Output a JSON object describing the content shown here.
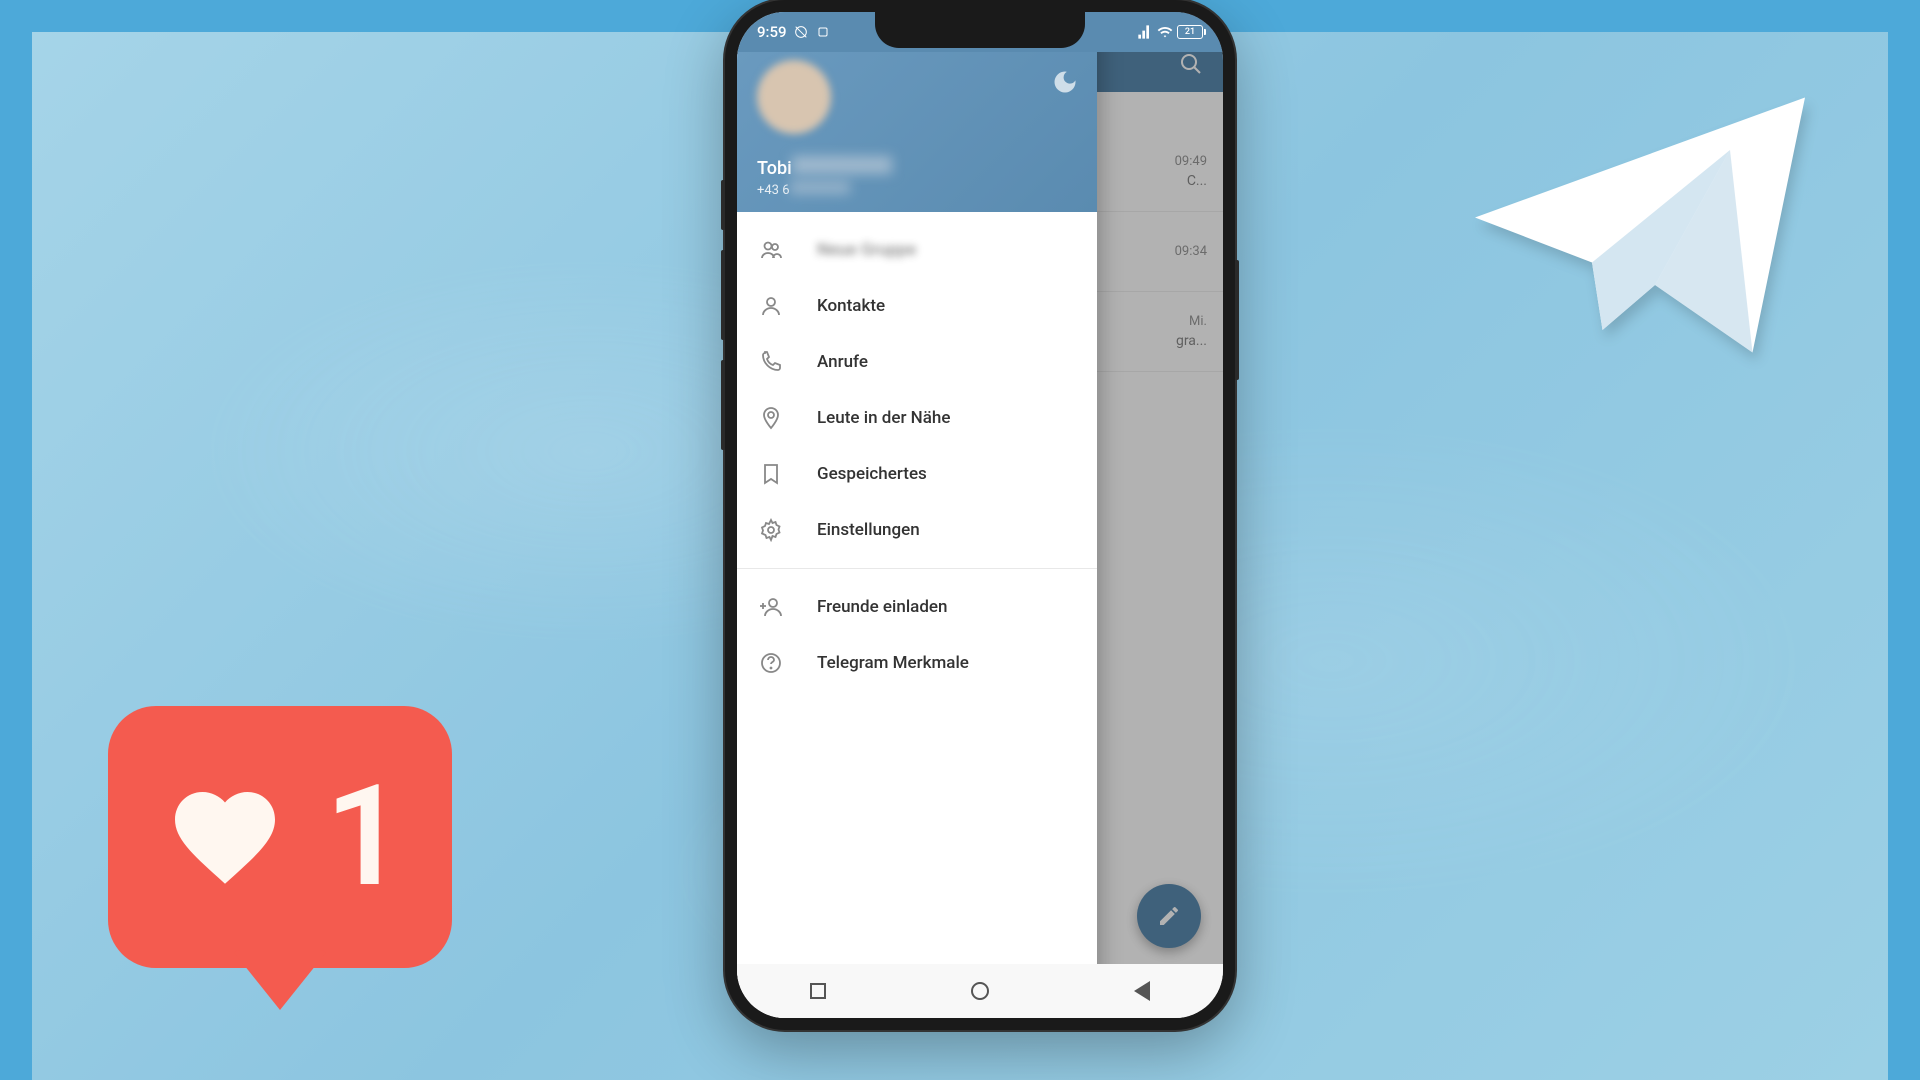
{
  "status_bar": {
    "time": "9:59",
    "battery": "21"
  },
  "drawer": {
    "user_name": "Tobi",
    "user_phone": "+43 6",
    "menu": {
      "new_group": "Neue Gruppe",
      "contacts": "Kontakte",
      "calls": "Anrufe",
      "nearby": "Leute in der Nähe",
      "saved": "Gespeichertes",
      "settings": "Einstellungen",
      "invite": "Freunde einladen",
      "features": "Telegram Merkmale"
    }
  },
  "chat_list": {
    "rows": [
      {
        "time": "09:49",
        "preview": "C..."
      },
      {
        "time": "09:34",
        "preview": ""
      },
      {
        "time": "Mi.",
        "preview": "gra..."
      }
    ]
  },
  "like_badge": {
    "count": "1"
  }
}
